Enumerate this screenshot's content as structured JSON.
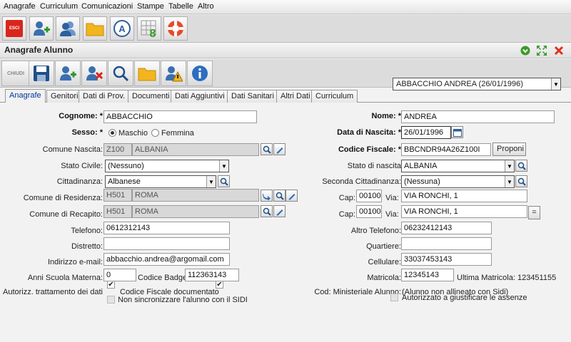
{
  "menu": [
    "Anagrafe",
    "Curriculum",
    "Comunicazioni",
    "Stampe",
    "Tabelle",
    "Altro"
  ],
  "toolbar": {
    "exit_label": "ESCI"
  },
  "window": {
    "title": "Anagrafe Alunno"
  },
  "subtoolbar": {
    "close_label": "CHIUDI"
  },
  "student_select": {
    "value": "ABBACCHIO ANDREA (26/01/1996)"
  },
  "tabs": [
    "Anagrafe",
    "Genitori",
    "Dati di Prov.",
    "Documenti",
    "Dati Aggiuntivi",
    "Dati Sanitari",
    "Altri Dati",
    "Curriculum"
  ],
  "form": {
    "cognome": {
      "label": "Cognome: *",
      "value": "ABBACCHIO"
    },
    "nome": {
      "label": "Nome: *",
      "value": "ANDREA"
    },
    "sesso": {
      "label": "Sesso: *",
      "opt1": "Maschio",
      "opt2": "Femmina",
      "selected": "Maschio"
    },
    "data_nascita": {
      "label": "Data di Nascita: *",
      "value": "26/01/1996"
    },
    "comune_nascita": {
      "label": "Comune Nascita:",
      "code": "Z100",
      "name": "ALBANIA"
    },
    "codice_fiscale": {
      "label": "Codice Fiscale: *",
      "value": "BBCNDR94A26Z100I",
      "button": "Proponi"
    },
    "stato_civile": {
      "label": "Stato Civile:",
      "value": "(Nessuno)"
    },
    "stato_nascita": {
      "label": "Stato di nascita",
      "value": "ALBANIA"
    },
    "cittadinanza": {
      "label": "Cittadinanza:",
      "value": "Albanese"
    },
    "seconda_cittadinanza": {
      "label": "Seconda Cittadinanza:",
      "value": "(Nessuna)"
    },
    "comune_residenza": {
      "label": "Comune di Residenza:",
      "code": "H501",
      "name": "ROMA"
    },
    "cap1": {
      "label": "Cap:",
      "value": "00100",
      "via_label": "Via:",
      "via": "VIA RONCHI, 1"
    },
    "comune_recapito": {
      "label": "Comune di Recapito:",
      "code": "H501",
      "name": "ROMA"
    },
    "cap2": {
      "label": "Cap:",
      "value": "00100",
      "via_label": "Via:",
      "via": "VIA RONCHI, 1",
      "button": "="
    },
    "telefono": {
      "label": "Telefono:",
      "value": "0612312143"
    },
    "altro_telefono": {
      "label": "Altro Telefono:",
      "value": "06232412143"
    },
    "distretto": {
      "label": "Distretto:",
      "value": ""
    },
    "quartiere": {
      "label": "Quartiere:",
      "value": ""
    },
    "email": {
      "label": "Indirizzo e-mail:",
      "value": "abbacchio.andrea@argomail.com"
    },
    "cellulare": {
      "label": "Cellulare:",
      "value": "33037453143"
    },
    "anni_materna": {
      "label": "Anni Scuola Materna:",
      "value": "0"
    },
    "codice_badge": {
      "label": "Codice Badge:",
      "value": "112363143"
    },
    "matricola": {
      "label": "Matricola:",
      "value": "12345143",
      "ultima_label": "Ultima Matricola: 123451155"
    },
    "autorizz": {
      "label": "Autorizz. trattamento dei dati",
      "checked": true
    },
    "cf_documentato": {
      "label": "Codice Fiscale documentato",
      "checked": true
    },
    "cod_ministeriale": {
      "label": "Cod: Ministeriale Alunno:",
      "value": "(Alunno non allineato con Sidi)"
    },
    "non_sincronizzare": {
      "label": "Non sincronizzare l'alunno con il SIDI",
      "checked": false
    },
    "autorizzato_giust": {
      "label": "Autorizzato a giustificare le assenze",
      "checked": false
    }
  },
  "colors": {
    "accent": "#003399",
    "exit_red": "#d9261c",
    "green": "#3a9a2a",
    "close_red": "#e03020"
  }
}
